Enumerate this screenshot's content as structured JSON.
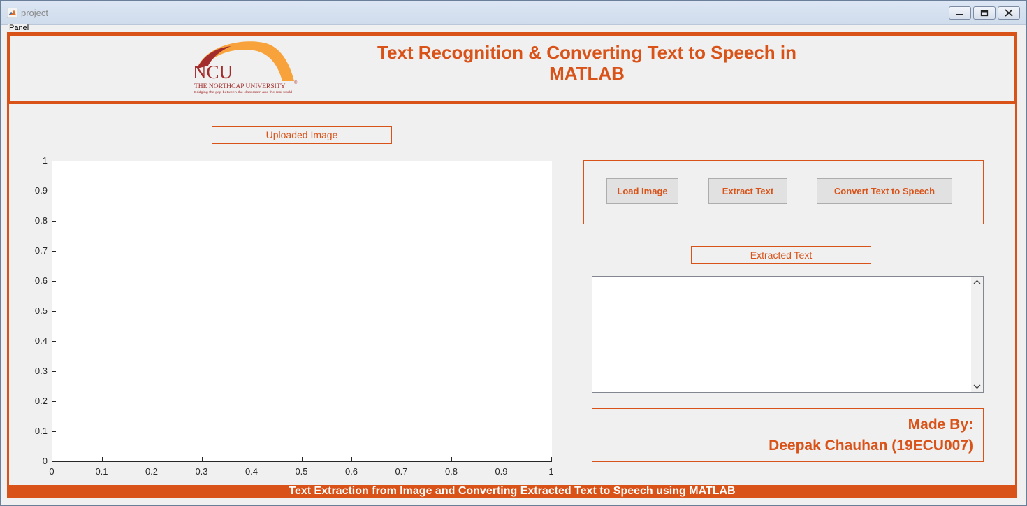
{
  "window": {
    "title": "project",
    "minimize_symbol": "▭",
    "maximize_symbol": "◻",
    "close_symbol": "✕"
  },
  "panel": {
    "label": "Panel"
  },
  "header": {
    "title_line1": "Text Recognition & Converting Text to Speech in",
    "title_line2": "MATLAB",
    "logo": {
      "text": "NCU",
      "subtitle": "THE NORTHCAP UNIVERSITY",
      "registered": "®",
      "tagline": "Bridging the gap between the classroom and the real world"
    }
  },
  "image_panel": {
    "label": "Uploaded Image",
    "yticks": [
      "1",
      "0.9",
      "0.8",
      "0.7",
      "0.6",
      "0.5",
      "0.4",
      "0.3",
      "0.2",
      "0.1",
      "0"
    ],
    "xticks": [
      "0",
      "0.1",
      "0.2",
      "0.3",
      "0.4",
      "0.5",
      "0.6",
      "0.7",
      "0.8",
      "0.9",
      "1"
    ]
  },
  "buttons": {
    "load": "Load Image",
    "extract": "Extract Text",
    "convert": "Convert Text to Speech"
  },
  "extracted": {
    "label": "Extracted Text",
    "value": "",
    "scroll_up": "^",
    "scroll_down": "v"
  },
  "credits": {
    "line1": "Made By:",
    "line2": "Deepak Chauhan (19ECU007)"
  },
  "footer": {
    "text": "Text Extraction from Image and Converting Extracted Text to Speech using MATLAB"
  },
  "colors": {
    "accent": "#d95319",
    "background": "#f0f0f0"
  }
}
